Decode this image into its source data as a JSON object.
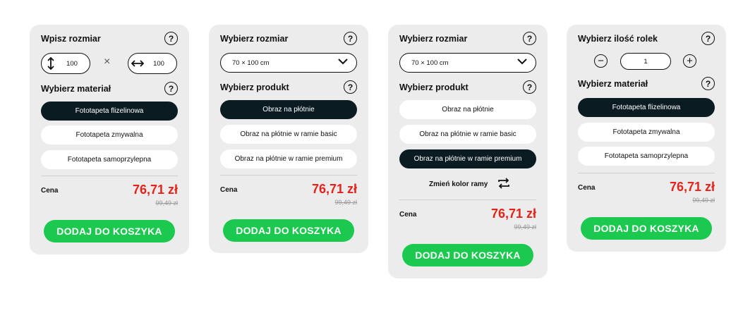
{
  "colors": {
    "card_bg": "#ececec",
    "selected": "#0a1b22",
    "price": "#e5231b",
    "cta": "#1bc94f"
  },
  "card1": {
    "size_heading": "Wpisz rozmiar",
    "help": "?",
    "height_value": "100",
    "width_value": "100",
    "times": "×",
    "material_heading": "Wybierz materiał",
    "materials": [
      "Fototapeta flizelinowa",
      "Fototapeta zmywalna",
      "Fototapeta samoprzylepna"
    ],
    "price_label": "Cena",
    "price": "76,71 zł",
    "old_price": "99,49 zł",
    "cta": "DODAJ DO KOSZYKA"
  },
  "card2": {
    "size_heading": "Wybierz rozmiar",
    "help": "?",
    "size_value": "70 × 100 cm",
    "product_heading": "Wybierz produkt",
    "products": [
      "Obraz na płótnie",
      "Obraz na płótnie w ramie basic",
      "Obraz na płótnie w ramie premium"
    ],
    "price_label": "Cena",
    "price": "76,71 zł",
    "old_price": "99,49 zł",
    "cta": "DODAJ DO KOSZYKA"
  },
  "card3": {
    "size_heading": "Wybierz rozmiar",
    "help": "?",
    "size_value": "70 × 100 cm",
    "product_heading": "Wybierz produkt",
    "products": [
      "Obraz na płótnie",
      "Obraz na płótnie w ramie basic",
      "Obraz na płótnie w ramie premium"
    ],
    "frame_color": "Zmień kolor ramy",
    "price_label": "Cena",
    "price": "76,71 zł",
    "old_price": "99,49 zł",
    "cta": "DODAJ DO KOSZYKA"
  },
  "card4": {
    "rolls_heading": "Wybierz ilość rolek",
    "help": "?",
    "minus": "−",
    "plus": "+",
    "quantity": "1",
    "material_heading": "Wybierz materiał",
    "materials": [
      "Fototapeta flizelinowa",
      "Fototapeta zmywalna",
      "Fototapeta samoprzylepna"
    ],
    "price_label": "Cena",
    "price": "76,71 zł",
    "old_price": "99,49 zł",
    "cta": "DODAJ DO KOSZYKA"
  }
}
